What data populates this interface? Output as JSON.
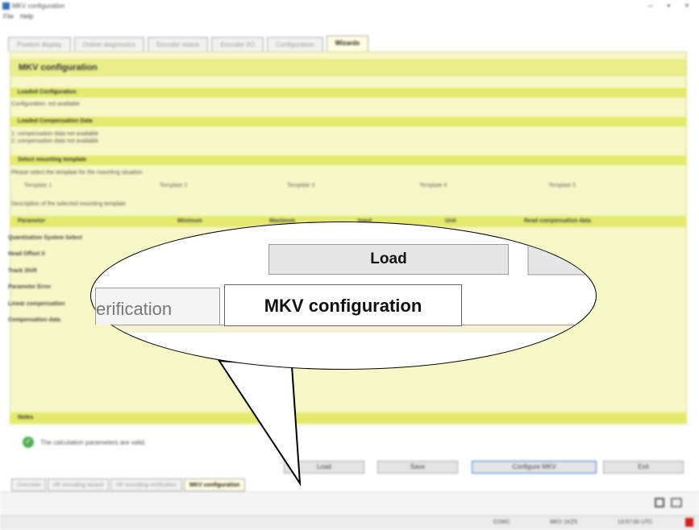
{
  "window": {
    "title": "MKV configuration",
    "controls": {
      "minimize": "–",
      "maximize": "▪",
      "close": "×"
    }
  },
  "menu": {
    "items": [
      "File",
      "Help"
    ]
  },
  "top_tabs": [
    {
      "label": "Position display",
      "active": false
    },
    {
      "label": "Online diagnostics",
      "active": false
    },
    {
      "label": "Encoder status",
      "active": false
    },
    {
      "label": "Encoder I/O",
      "active": false
    },
    {
      "label": "Configuration",
      "active": false
    },
    {
      "label": "Wizards",
      "active": true
    }
  ],
  "panel": {
    "title": "MKV configuration",
    "sections": {
      "loaded_configuration": "Loaded Configuration",
      "loaded_configuration_value": "Configuration: not available",
      "loaded_compensation": "Loaded Compensation Data",
      "loaded_compensation_lines": [
        "1: compensation data not available",
        "2: compensation data not available"
      ],
      "select_template": "Select mounting template",
      "select_template_hint": "Please select the template for the mounting situation",
      "template_options": [
        "Template 1",
        "Template 2",
        "Template 3",
        "Template 4",
        "Template 5"
      ],
      "template_description": "Description of the selected mounting template"
    },
    "columns": [
      "Parameter",
      "Minimum",
      "Maximum",
      "Input",
      "Unit",
      "Read compensation data"
    ],
    "params": [
      "Quantization System Select",
      "Head Offset X",
      "Track Shift",
      "Parameter Error",
      "Linear compensation",
      "Compensation data"
    ]
  },
  "notes": {
    "title": "Notes",
    "message": "The calculation parameters are valid."
  },
  "buttons": {
    "load": "Load",
    "save": "Save",
    "configure": "Configure MKV",
    "exit": "Exit"
  },
  "bottom_tabs": [
    {
      "label": "Overview",
      "active": false
    },
    {
      "label": "HF encoding wizard",
      "active": false
    },
    {
      "label": "HF encoding verification",
      "active": false
    },
    {
      "label": "MKV configuration",
      "active": true
    }
  ],
  "status": {
    "port": "COM1",
    "device": "MKV 1KZ5",
    "time": "13:57:00 UTC",
    "led_color": "#d32020"
  },
  "callout": {
    "load_label": "Load",
    "prev_tab_fragment": "erification",
    "active_tab_label": "MKV configuration"
  },
  "colors": {
    "panel_bg": "#f7f7c8",
    "section_bg": "#e3ea6d",
    "title_bg": "#e9ee8a",
    "accent": "#3a7bd5"
  }
}
